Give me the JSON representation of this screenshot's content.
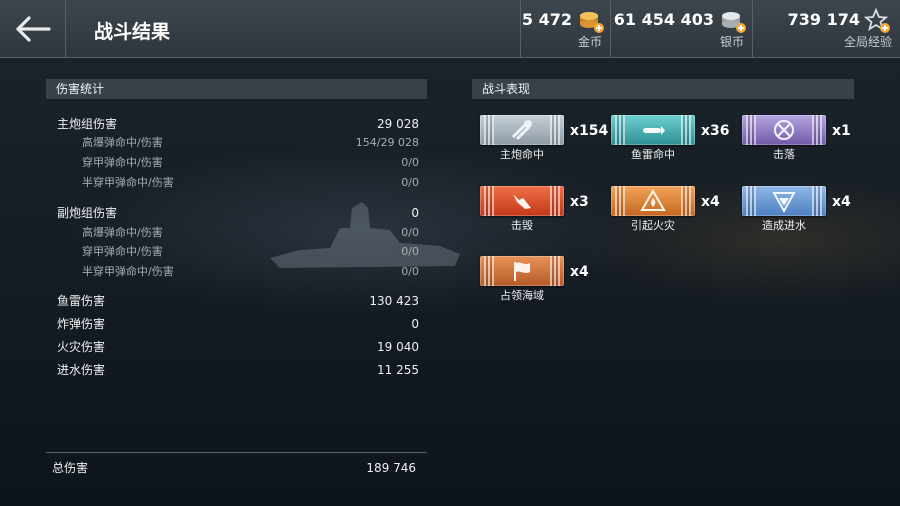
{
  "header": {
    "title": "战斗结果",
    "resources": [
      {
        "id": "gold",
        "amount": "5 472",
        "label": "金币",
        "icon": "gold-coins-add-icon"
      },
      {
        "id": "silver",
        "amount": "61 454 403",
        "label": "银币",
        "icon": "silver-coins-add-icon"
      },
      {
        "id": "xp",
        "amount": "739 174",
        "label": "全局经验",
        "icon": "star-xp-add-icon"
      }
    ]
  },
  "damage": {
    "title": "伤害统计",
    "main_battery": {
      "label": "主炮组伤害",
      "value": "29 028"
    },
    "main_he": {
      "label": "高爆弹命中/伤害",
      "value": "154/29 028"
    },
    "main_ap": {
      "label": "穿甲弹命中/伤害",
      "value": "0/0"
    },
    "main_sap": {
      "label": "半穿甲弹命中/伤害",
      "value": "0/0"
    },
    "secondary": {
      "label": "副炮组伤害",
      "value": "0"
    },
    "sec_he": {
      "label": "高爆弹命中/伤害",
      "value": "0/0"
    },
    "sec_ap": {
      "label": "穿甲弹命中/伤害",
      "value": "0/0"
    },
    "sec_sap": {
      "label": "半穿甲弹命中/伤害",
      "value": "0/0"
    },
    "torpedo": {
      "label": "鱼雷伤害",
      "value": "130 423"
    },
    "bomb": {
      "label": "炸弹伤害",
      "value": "0"
    },
    "fire": {
      "label": "火灾伤害",
      "value": "19 040"
    },
    "flood": {
      "label": "进水伤害",
      "value": "11 255"
    },
    "total": {
      "label": "总伤害",
      "value": "189 746"
    }
  },
  "performance": {
    "title": "战斗表现",
    "medals": [
      {
        "label": "主炮命中",
        "count": "x154",
        "color": "#9aa6b0",
        "icon": "main-battery-hit-icon"
      },
      {
        "label": "鱼雷命中",
        "count": "x36",
        "color": "#3aa3a5",
        "icon": "torpedo-hit-icon"
      },
      {
        "label": "击落",
        "count": "x1",
        "color": "#8270bc",
        "icon": "aircraft-shot-down-icon"
      },
      {
        "label": "击毁",
        "count": "x3",
        "color": "#d84a24",
        "icon": "ship-destroyed-icon"
      },
      {
        "label": "引起火灾",
        "count": "x4",
        "color": "#d67a2e",
        "icon": "fire-caused-icon"
      },
      {
        "label": "造成进水",
        "count": "x4",
        "color": "#5f8fcc",
        "icon": "flooding-caused-icon"
      },
      {
        "label": "占领海域",
        "count": "x4",
        "color": "#c76a35",
        "icon": "capture-flag-icon"
      }
    ]
  }
}
